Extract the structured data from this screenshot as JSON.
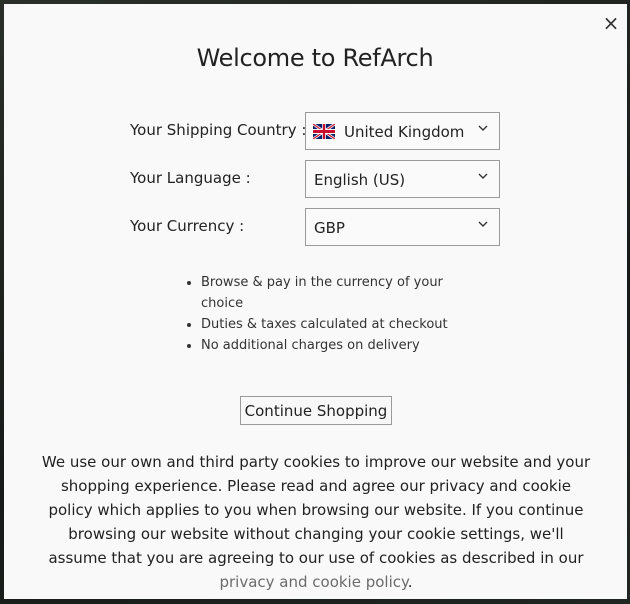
{
  "modal": {
    "title": "Welcome to RefArch",
    "close_symbol": "×",
    "close_icon": "close-icon"
  },
  "fields": {
    "country": {
      "label": "Your Shipping Country :",
      "value": "United Kingdom",
      "flag_icon": "uk-flag-icon"
    },
    "language": {
      "label": "Your Language :",
      "value": "English (US)"
    },
    "currency": {
      "label": "Your Currency :",
      "value": "GBP"
    }
  },
  "benefits": [
    "Browse & pay in the currency of your choice",
    "Duties & taxes calculated at checkout",
    "No additional charges on delivery"
  ],
  "continue_label": "Continue Shopping",
  "cookie": {
    "text": "We use our own and third party cookies to improve our website and your shopping experience. Please read and agree our privacy and cookie policy which applies to you when browsing our website. If you continue browsing our website without changing your cookie settings, we'll assume that you are agreeing to our use of cookies as described in our ",
    "link_text": "privacy and cookie policy",
    "end": "."
  },
  "colors": {
    "modal_background": "#f9f9f9",
    "link": "#6b6b6b",
    "border": "#9a9a9a"
  }
}
